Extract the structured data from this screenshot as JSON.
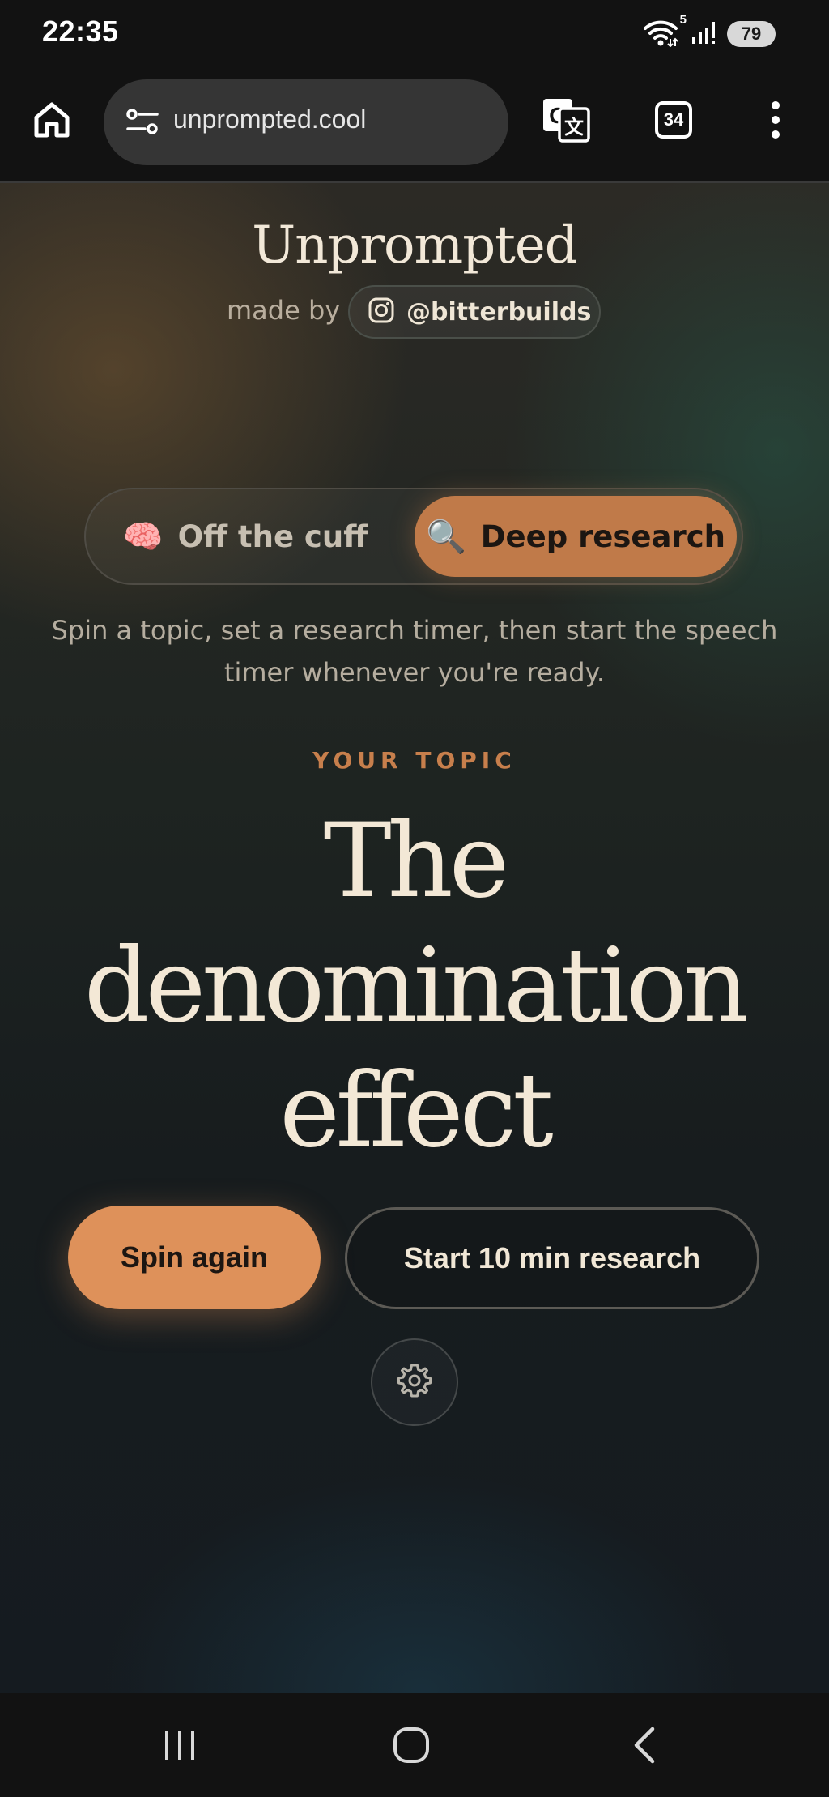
{
  "status_bar": {
    "time": "22:35",
    "wifi_badge": "5",
    "battery": "79",
    "icons": [
      "wifi-icon",
      "signal-icon",
      "battery-icon"
    ]
  },
  "browser": {
    "url": "unprompted.cool",
    "tab_count": "34",
    "icons": [
      "home-icon",
      "site-settings-icon",
      "translate-icon",
      "tabs-icon",
      "more-menu-icon"
    ]
  },
  "header": {
    "title": "Unprompted",
    "made_by_label": "made by",
    "instagram_handle": "@bitterbuilds"
  },
  "modes": {
    "off_the_cuff": {
      "emoji": "🧠",
      "label": "Off the cuff",
      "selected": false
    },
    "deep_research": {
      "emoji": "🔍",
      "label": "Deep research",
      "selected": true
    }
  },
  "description": "Spin a topic, set a research timer, then start the speech timer whenever you're ready.",
  "topic": {
    "label": "YOUR TOPIC",
    "text": "The denomination effect"
  },
  "actions": {
    "spin_label": "Spin again",
    "research_label": "Start 10 min research"
  },
  "nav": {
    "icons": [
      "recent-apps-icon",
      "home-circle-icon",
      "back-icon"
    ]
  },
  "colors": {
    "accent": "#de915a",
    "accent_selected": "#c07a49",
    "topic_label": "#c77f4c",
    "text_light": "#f3e8d6",
    "background": "#171c1e"
  }
}
